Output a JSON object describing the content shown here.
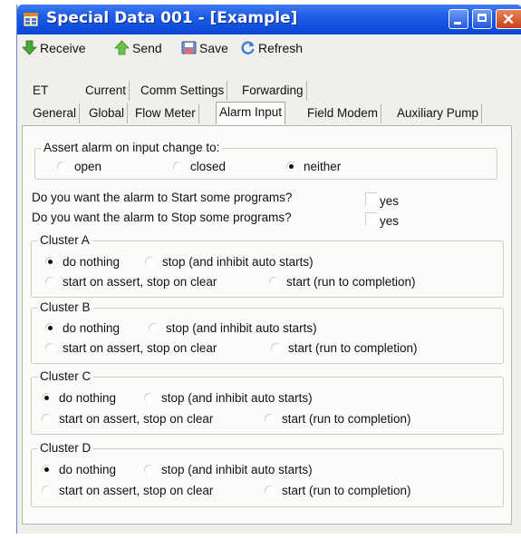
{
  "window": {
    "title": "Special Data 001 - [Example]"
  },
  "toolbar": {
    "receive": "Receive",
    "send": "Send",
    "save": "Save",
    "refresh": "Refresh"
  },
  "tabs": {
    "row1": [
      "ET",
      "Current",
      "Comm Settings",
      "Forwarding"
    ],
    "row2": [
      "General",
      "Global",
      "Flow Meter",
      "Alarm Input",
      "Field Modem",
      "Auxiliary Pump"
    ],
    "active": "Alarm Input"
  },
  "assert": {
    "label": "Assert alarm on input change to:",
    "options": [
      "open",
      "closed",
      "neither"
    ],
    "selected": "neither"
  },
  "questions": {
    "start_label": "Do you want the alarm to Start some programs?",
    "start_yes": "yes",
    "start_checked": false,
    "stop_label": "Do you want the alarm to Stop some programs?",
    "stop_yes": "yes",
    "stop_checked": false
  },
  "options": {
    "do_nothing": "do nothing",
    "stop": "stop (and inhibit auto starts)",
    "start_assert": "start on assert, stop on clear",
    "start_run": "start (run to completion)"
  },
  "clusters": [
    {
      "name": "Cluster A",
      "selected": "do nothing"
    },
    {
      "name": "Cluster B",
      "selected": "do nothing"
    },
    {
      "name": "Cluster C",
      "selected": "do nothing"
    },
    {
      "name": "Cluster D",
      "selected": "do nothing"
    }
  ],
  "colors": {
    "titlebar": "#0a46d8",
    "window_bg": "#f0efe9",
    "panel_bg": "#fbfbf9"
  },
  "icons": {
    "app": "app-window-icon",
    "receive": "arrow-down-green-icon",
    "send": "arrow-up-green-icon",
    "save": "floppy-disk-icon",
    "refresh": "refresh-icon"
  }
}
